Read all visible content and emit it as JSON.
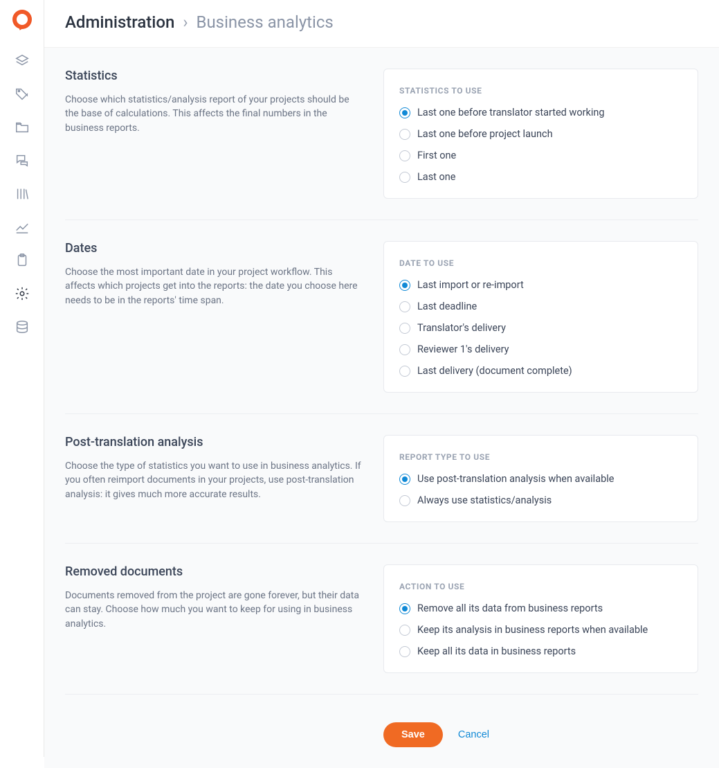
{
  "breadcrumb": {
    "root": "Administration",
    "current": "Business analytics"
  },
  "sections": {
    "statistics": {
      "title": "Statistics",
      "desc": "Choose which statistics/analysis report of your projects should be the base of calculations. This affects the final numbers in the business reports.",
      "card_label": "Statistics to use",
      "options": [
        {
          "label": "Last one before translator started working",
          "selected": true
        },
        {
          "label": "Last one before project launch",
          "selected": false
        },
        {
          "label": "First one",
          "selected": false
        },
        {
          "label": "Last one",
          "selected": false
        }
      ]
    },
    "dates": {
      "title": "Dates",
      "desc": "Choose the most important date in your project workflow. This affects which projects get into the reports: the date you choose here needs to be in the reports' time span.",
      "card_label": "Date to use",
      "options": [
        {
          "label": "Last import or re-import",
          "selected": true
        },
        {
          "label": "Last deadline",
          "selected": false
        },
        {
          "label": "Translator's delivery",
          "selected": false
        },
        {
          "label": "Reviewer 1's delivery",
          "selected": false
        },
        {
          "label": "Last delivery (document complete)",
          "selected": false
        }
      ]
    },
    "pta": {
      "title": "Post-translation analysis",
      "desc": "Choose the type of statistics you want to use in business analytics. If you often reimport documents in your projects, use post-translation analysis: it gives much more accurate results.",
      "card_label": "Report type to use",
      "options": [
        {
          "label": "Use post-translation analysis when available",
          "selected": true
        },
        {
          "label": "Always use statistics/analysis",
          "selected": false
        }
      ]
    },
    "removed": {
      "title": "Removed documents",
      "desc": "Documents removed from the project are gone forever, but their data can stay. Choose how much you want to keep for using in business analytics.",
      "card_label": "Action to use",
      "options": [
        {
          "label": "Remove all its data from business reports",
          "selected": true
        },
        {
          "label": "Keep its analysis in business reports when available",
          "selected": false
        },
        {
          "label": "Keep all its data in business reports",
          "selected": false
        }
      ]
    }
  },
  "actions": {
    "save": "Save",
    "cancel": "Cancel"
  }
}
